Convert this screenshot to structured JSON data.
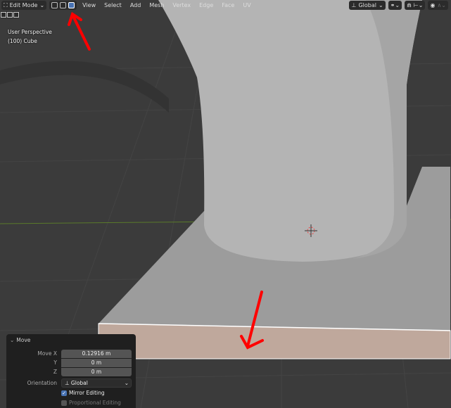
{
  "header": {
    "mode": "Edit Mode",
    "menus": [
      "View",
      "Select",
      "Add",
      "Mesh",
      "Vertex",
      "Edge",
      "Face",
      "UV"
    ],
    "orientation": "Global"
  },
  "viewport": {
    "view_name": "User Perspective",
    "object": "(100) Cube"
  },
  "operator_panel": {
    "title": "Move",
    "fields": [
      {
        "label": "Move X",
        "value": "0.12916 m"
      },
      {
        "label": "Y",
        "value": "0 m"
      },
      {
        "label": "Z",
        "value": "0 m"
      }
    ],
    "orientation_label": "Orientation",
    "orientation_value": "Global",
    "mirror_editing": "Mirror Editing",
    "mirror_checked": true,
    "proportional_editing": "Proportional Editing",
    "proportional_checked": false
  },
  "colors": {
    "accent": "#4772b3",
    "annotation": "#ff0000"
  }
}
